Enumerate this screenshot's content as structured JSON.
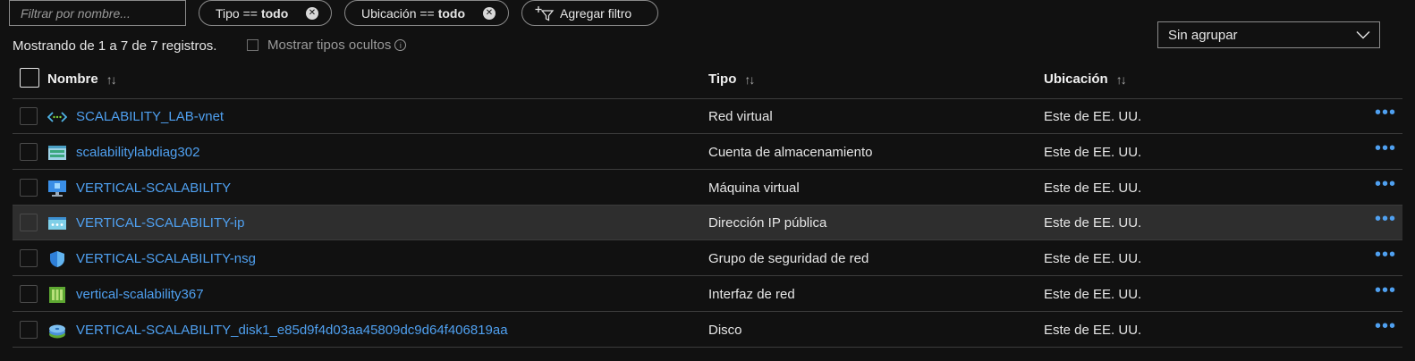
{
  "filter": {
    "placeholder": "Filtrar por nombre..."
  },
  "pills": [
    {
      "key": "Tipo ==",
      "value": "todo"
    },
    {
      "key": "Ubicación ==",
      "value": "todo"
    }
  ],
  "add_filter_label": "Agregar filtro",
  "status_text": "Mostrando de 1 a 7 de 7 registros.",
  "show_hidden_label": "Mostrar tipos ocultos",
  "group_select": {
    "value": "Sin agrupar"
  },
  "columns": {
    "name": "Nombre",
    "type": "Tipo",
    "location": "Ubicación"
  },
  "rows": [
    {
      "name": "SCALABILITY_LAB-vnet",
      "type": "Red virtual",
      "location": "Este de EE. UU.",
      "icon": "virtual-network-icon"
    },
    {
      "name": "scalabilitylabdiag302",
      "type": "Cuenta de almacenamiento",
      "location": "Este de EE. UU.",
      "icon": "storage-account-icon"
    },
    {
      "name": "VERTICAL-SCALABILITY",
      "type": "Máquina virtual",
      "location": "Este de EE. UU.",
      "icon": "virtual-machine-icon"
    },
    {
      "name": "VERTICAL-SCALABILITY-ip",
      "type": "Dirección IP pública",
      "location": "Este de EE. UU.",
      "icon": "public-ip-icon"
    },
    {
      "name": "VERTICAL-SCALABILITY-nsg",
      "type": "Grupo de seguridad de red",
      "location": "Este de EE. UU.",
      "icon": "network-security-group-icon"
    },
    {
      "name": "vertical-scalability367",
      "type": "Interfaz de red",
      "location": "Este de EE. UU.",
      "icon": "network-interface-icon"
    },
    {
      "name": "VERTICAL-SCALABILITY_disk1_e85d9f4d03aa45809dc9d64f406819aa",
      "type": "Disco",
      "location": "Este de EE. UU.",
      "icon": "disk-icon"
    }
  ],
  "colors": {
    "link": "#4fa0f0",
    "background": "#111111",
    "highlight_row": "#2e2e2e"
  }
}
